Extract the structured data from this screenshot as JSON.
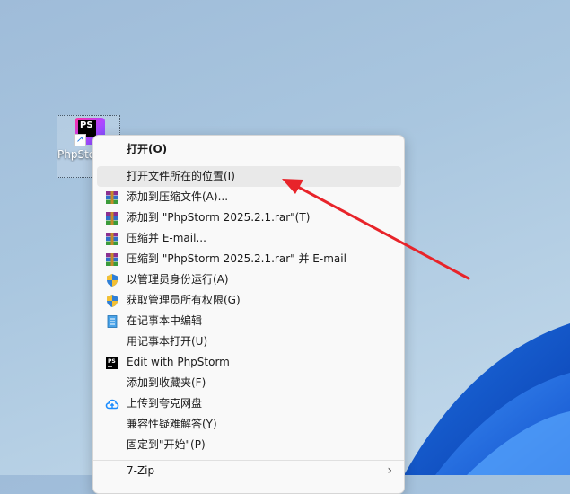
{
  "desktop": {
    "icon": {
      "label": "PhpStorm 2025",
      "logo_text": "PS",
      "shortcut_glyph": "↗"
    }
  },
  "context_menu": {
    "items": [
      {
        "label": "打开(O)",
        "icon": "none",
        "bold": true
      },
      {
        "label": "打开文件所在的位置(I)",
        "icon": "none",
        "highlighted": true
      },
      {
        "label": "添加到压缩文件(A)...",
        "icon": "winrar-icon"
      },
      {
        "label": "添加到 \"PhpStorm 2025.2.1.rar\"(T)",
        "icon": "winrar-icon"
      },
      {
        "label": "压缩并 E-mail...",
        "icon": "winrar-icon"
      },
      {
        "label": "压缩到 \"PhpStorm 2025.2.1.rar\" 并 E-mail",
        "icon": "winrar-icon"
      },
      {
        "label": "以管理员身份运行(A)",
        "icon": "uac-shield-icon"
      },
      {
        "label": "获取管理员所有权限(G)",
        "icon": "uac-shield-icon"
      },
      {
        "label": "在记事本中编辑",
        "icon": "notepad-icon"
      },
      {
        "label": "用记事本打开(U)",
        "icon": "none"
      },
      {
        "label": "Edit with PhpStorm",
        "icon": "phpstorm-icon"
      },
      {
        "label": "添加到收藏夹(F)",
        "icon": "none"
      },
      {
        "label": "上传到夸克网盘",
        "icon": "quark-cloud-icon"
      },
      {
        "label": "兼容性疑难解答(Y)",
        "icon": "none"
      },
      {
        "label": "固定到\"开始\"(P)",
        "icon": "none"
      },
      {
        "label": "7-Zip",
        "icon": "none",
        "submenu": true,
        "chevron": "›"
      }
    ]
  },
  "annotation": {
    "arrow_color": "#e8242a"
  },
  "colors": {
    "menu_bg": "#f9f9f9",
    "hover_bg": "#e9e9e9",
    "arrow": "#e8242a"
  }
}
